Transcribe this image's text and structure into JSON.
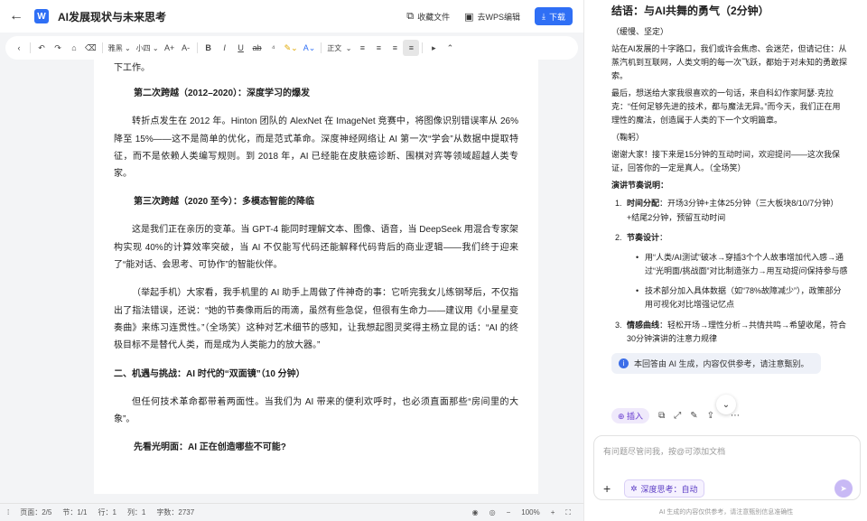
{
  "header": {
    "back_icon": "arrow-left-icon",
    "app_icon_letter": "W",
    "title": "AI发展现状与未来思考",
    "favorite_label": "收藏文件",
    "wps_edit_label": "去WPS编辑",
    "download_label": "下载"
  },
  "toolbar": {
    "font_name": "雅黑",
    "font_size": "小四",
    "grow_icon": "A+",
    "shrink_icon": "A-",
    "bold": "B",
    "italic": "I",
    "underline": "U",
    "strike": "ab",
    "style_label": "正文"
  },
  "document": {
    "p0": "下工作。",
    "h1": "第二次跨越（2012–2020）：深度学习的爆发",
    "p1": "转折点发生在 2012 年。Hinton 团队的 AlexNet 在 ImageNet 竞赛中，将图像识别错误率从 26%降至 15%——这不是简单的优化，而是范式革命。深度神经网络让 AI 第一次“学会”从数据中提取特征，而不是依赖人类编写规则。到 2018 年，AI 已经能在皮肤癌诊断、围棋对弈等领域超越人类专家。",
    "h2": "第三次跨越（2020 至今）：多模态智能的降临",
    "p2": "这是我们正在亲历的变革。当 GPT-4 能同时理解文本、图像、语音，当 DeepSeek 用混合专家架构实现 40%的计算效率突破，当 AI 不仅能写代码还能解释代码背后的商业逻辑——我们终于迎来了“能对话、会思考、可协作”的智能伙伴。",
    "p3": "（举起手机）大家看，我手机里的 AI 助手上周做了件神奇的事：它听完我女儿练钢琴后，不仅指出了指法错误，还说：“她的节奏像雨后的雨滴，虽然有些急促，但很有生命力——建议用《小星星变奏曲》来练习连贯性。”（全场笑）这种对艺术细节的感知，让我想起图灵奖得主杨立昆的话：“AI 的终极目标不是替代人类，而是成为人类能力的放大器。”",
    "h3": "二、机遇与挑战：AI 时代的“双面镜”（10 分钟）",
    "p4": "但任何技术革命都带着两面性。当我们为 AI 带来的便利欢呼时，也必须直面那些“房间里的大象”。",
    "h4": "先看光明面：AI 正在创造哪些不可能?"
  },
  "status": {
    "page": "页面：2/5",
    "section": "节：1/1",
    "row": "行：1",
    "col": "列：1",
    "words": "字数：2737",
    "zoom": "100%"
  },
  "chat": {
    "heading": "结语：与AI共舞的勇气（2分钟）",
    "tone": "（缓慢、坚定）",
    "para1": "站在AI发展的十字路口，我们或许会焦虑、会迷茫，但请记住：从蒸汽机到互联网，人类文明的每一次飞跃，都始于对未知的勇敢探索。",
    "para2": "最后，想送给大家我很喜欢的一句话，来自科幻作家阿瑟·克拉克：“任何足够先进的技术，都与魔法无异。”而今天，我们正在用理性的魔法，创造属于人类的下一个文明篇章。",
    "bow": "（鞠躬）",
    "para3": "谢谢大家！接下来是15分钟的互动时间，欢迎提问——这次我保证，回答你的一定是真人。（全场笑）",
    "rhythm_label": "演讲节奏说明：",
    "item1_num": "1.",
    "item1_title": "时间分配",
    "item1_text": "：开场3分钟+主体25分钟（三大板块8/10/7分钟）+结尾2分钟，预留互动时间",
    "item2_num": "2.",
    "item2_title": "节奏设计",
    "item2_text": "：",
    "bullet1": "用“人类/AI测试”破冰→穿插3个个人故事增加代入感→通过“光明面/挑战面”对比制造张力→用互动提问保持参与感",
    "bullet2": "技术部分加入具体数据（如“78%故障减少”），政策部分用可视化对比增强记忆点",
    "item3_num": "3.",
    "item3_title": "情感曲线",
    "item3_text": "：轻松开场→理性分析→共情共鸣→希望收尾，符合30分钟演讲的注意力规律",
    "notice": "本回答由 AI 生成，内容仅供参考，请注意甄别。",
    "insert_label": "插入",
    "input_placeholder": "有问题尽管问我，按@可添加文档",
    "deep_think_label": "深度思考：自动",
    "disclaimer": "AI 生成的内容仅供参考，请注意甄别信息准确性"
  },
  "colors": {
    "accent": "#2f6ff5",
    "purple": "#6a3fd0"
  }
}
